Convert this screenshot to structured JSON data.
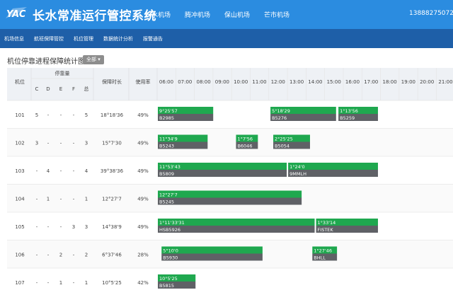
{
  "app": {
    "logo_text": "YAC",
    "title": "长水常准运行管控系统",
    "airports": [
      "长水机场",
      "腾冲机场",
      "保山机场",
      "芒市机场"
    ],
    "phone": "13888275072"
  },
  "subnav": [
    "机场信息",
    "航班保障管控",
    "机位管理",
    "数据统计分析",
    "报警通告"
  ],
  "page": {
    "title": "机位停靠进程保障统计图",
    "filter_label": "全部"
  },
  "table": {
    "header_stand": "机位",
    "header_parking_group": "停靠量",
    "parking_columns": [
      "C",
      "D",
      "E",
      "F",
      "总"
    ],
    "header_duration": "保障时长",
    "header_usage": "使用率",
    "hours": [
      "06:00",
      "07:00",
      "08:00",
      "09:00",
      "10:00",
      "11:00",
      "12:00",
      "13:00",
      "14:00",
      "15:00",
      "16:00",
      "17:00",
      "18:00",
      "19:00",
      "20:00",
      "21:00"
    ],
    "rows": [
      {
        "stand": "101",
        "C": "5",
        "D": "-",
        "E": "-",
        "F": "-",
        "total": "5",
        "duration": "18°18'36",
        "usage": "49%",
        "flights": [
          {
            "start": 6.0,
            "end": 9.05,
            "time": "9°25'57",
            "reg": "B2985"
          },
          {
            "start": 12.05,
            "end": 15.65,
            "time": "5°18'29",
            "reg": "B5276"
          },
          {
            "start": 15.7,
            "end": 17.9,
            "time": "1°13'56",
            "reg": "B5259"
          }
        ]
      },
      {
        "stand": "102",
        "C": "3",
        "D": "-",
        "E": "-",
        "F": "-",
        "total": "3",
        "duration": "15°7'30",
        "usage": "49%",
        "flights": [
          {
            "start": 6.0,
            "end": 8.75,
            "time": "11°34'9",
            "reg": "B5243"
          },
          {
            "start": 10.2,
            "end": 11.45,
            "time": "1°7'56",
            "reg": "B6046"
          },
          {
            "start": 12.2,
            "end": 14.25,
            "time": "2°25'25",
            "reg": "B5054"
          }
        ]
      },
      {
        "stand": "103",
        "C": "-",
        "D": "4",
        "E": "-",
        "F": "-",
        "total": "4",
        "duration": "39°38'36",
        "usage": "49%",
        "flights": [
          {
            "start": 6.0,
            "end": 13.0,
            "time": "11°53'43",
            "reg": "B5809"
          },
          {
            "start": 13.0,
            "end": 17.9,
            "time": "1°24'0",
            "reg": "9MMLH"
          }
        ]
      },
      {
        "stand": "104",
        "C": "-",
        "D": "1",
        "E": "-",
        "F": "-",
        "total": "1",
        "duration": "12°27'7",
        "usage": "49%",
        "flights": [
          {
            "start": 6.0,
            "end": 13.8,
            "time": "12°27'7",
            "reg": "B5245"
          }
        ]
      },
      {
        "stand": "105",
        "C": "-",
        "D": "-",
        "E": "-",
        "F": "3",
        "total": "3",
        "duration": "14°38'9",
        "usage": "49%",
        "flights": [
          {
            "start": 6.0,
            "end": 14.5,
            "time": "1°11'33'31",
            "reg": "HSB5926"
          },
          {
            "start": 14.5,
            "end": 17.9,
            "time": "1°33'14",
            "reg": "FISTEK"
          }
        ]
      },
      {
        "stand": "106",
        "C": "-",
        "D": "-",
        "E": "2",
        "F": "-",
        "total": "2",
        "duration": "6°37'46",
        "usage": "28%",
        "flights": [
          {
            "start": 6.2,
            "end": 11.7,
            "time": "5°10'0",
            "reg": "B5930"
          },
          {
            "start": 14.3,
            "end": 15.7,
            "time": "1°27'46",
            "reg": "BHLL"
          }
        ]
      },
      {
        "stand": "107",
        "C": "-",
        "D": "-",
        "E": "1",
        "F": "-",
        "total": "1",
        "duration": "10°5'25",
        "usage": "42%",
        "flights": [
          {
            "start": 6.0,
            "end": 8.1,
            "time": "10°5'25",
            "reg": "B5815"
          }
        ]
      }
    ]
  },
  "colors": {
    "header_blue": "#2b8ce0",
    "subnav_blue": "#1e5fa8",
    "bar_green": "#1fa84f",
    "bar_gray": "#5f6166"
  }
}
